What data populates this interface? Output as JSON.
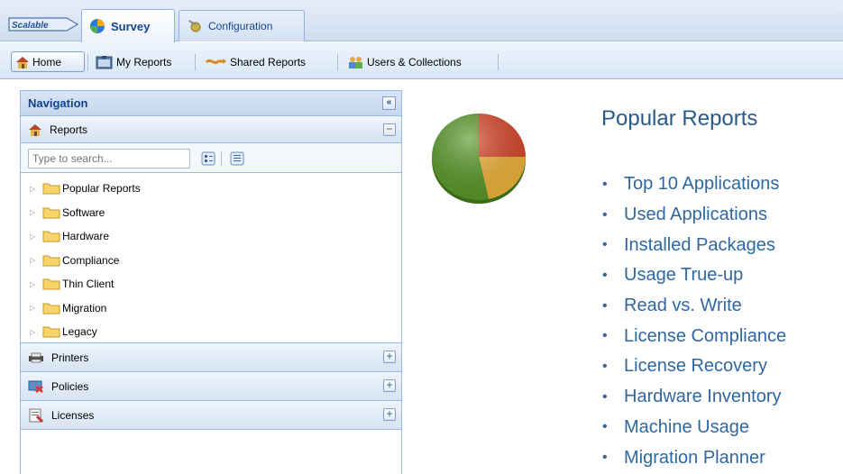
{
  "header": {
    "logo_text": "Scalable",
    "tabs": [
      {
        "label": "Survey",
        "active": true,
        "icon": "globe-icon"
      },
      {
        "label": "Configuration",
        "active": false,
        "icon": "wrench-gear-icon"
      }
    ]
  },
  "toolbar": {
    "buttons": [
      {
        "label": "Home",
        "icon": "home-icon",
        "active": true
      },
      {
        "label": "My Reports",
        "icon": "my-reports-icon"
      },
      {
        "label": "Shared Reports",
        "icon": "shared-reports-icon"
      },
      {
        "label": "Users & Collections",
        "icon": "users-icon"
      }
    ]
  },
  "navigation": {
    "title": "Navigation",
    "collapse_glyph": "«",
    "reports": {
      "label": "Reports",
      "search_placeholder": "Type to search...",
      "folders": [
        "Popular Reports",
        "Software",
        "Hardware",
        "Compliance",
        "Thin Client",
        "Migration",
        "Legacy"
      ]
    },
    "sections": [
      {
        "label": "Printers",
        "icon": "printer-icon"
      },
      {
        "label": "Policies",
        "icon": "policies-icon"
      },
      {
        "label": "Licenses",
        "icon": "licenses-icon"
      }
    ],
    "collapse_symbol": "−",
    "expand_symbol": "+"
  },
  "main": {
    "title": "Popular Reports",
    "reports": [
      "Top 10 Applications",
      "Used Applications",
      "Installed Packages",
      "Usage True-up",
      "Read vs. Write",
      "License Compliance",
      "License Recovery",
      "Hardware Inventory",
      "Machine Usage",
      "Migration Planner"
    ],
    "bullet": "•"
  },
  "colors": {
    "accent_blue": "#15428b",
    "link_blue": "#2f67a0",
    "border_blue": "#99bbe8",
    "pie_red": "#d9472b",
    "pie_green": "#5a9a2a",
    "pie_yellow": "#f2b53a"
  }
}
